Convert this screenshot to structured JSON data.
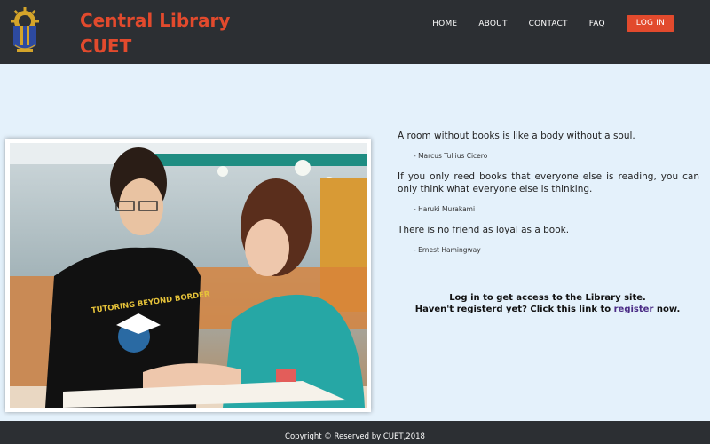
{
  "header": {
    "brand_line1": "Central Library",
    "brand_line2": "CUET",
    "nav": {
      "home": "HOME",
      "about": "ABOUT",
      "contact": "CONTACT",
      "faq": "FAQ",
      "login": "LOG IN"
    }
  },
  "photo": {
    "shirt_text": "TUTORING BEYOND BORDER"
  },
  "quotes": [
    {
      "text": "A room without books is like a body without a soul.",
      "author": "- Marcus Tullius Cicero"
    },
    {
      "text": "If you only reed books that everyone else is reading, you can only think what everyone else is thinking.",
      "author": "- Haruki Murakami"
    },
    {
      "text": "There is no friend as loyal as a book.",
      "author": "- Ernest Hamingway"
    }
  ],
  "cta": {
    "line1": "Log in to get access to the Library site.",
    "line2_pre": "Haven't registerd yet? Click this link to ",
    "link": "register",
    "line2_post": " now."
  },
  "footer": {
    "text": "Copyright © Reserved by CUET,2018"
  },
  "colors": {
    "accent": "#e24a2d",
    "header_bg": "#2c2f33",
    "page_bg": "#e4f1fb",
    "link": "#4b2c86"
  }
}
